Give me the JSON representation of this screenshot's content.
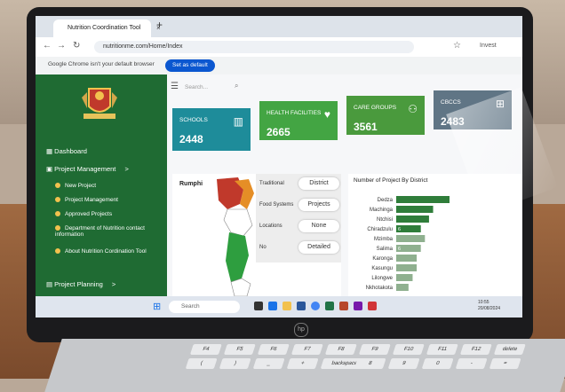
{
  "browser": {
    "tab_title": "Nutrition Coordination Tool",
    "tab_close": "×",
    "new_tab": "+",
    "url": "nutritionme.com/Home/Index",
    "infobar_text": "Google Chrome isn't your default browser",
    "set_default": "Set as default",
    "profile": "Invest"
  },
  "sidebar": {
    "items": [
      {
        "label": "Dashboard"
      },
      {
        "label": "Project Management",
        "arrow": ">"
      },
      {
        "label": "Project Planning",
        "arrow": ">"
      }
    ],
    "sub_items": [
      {
        "label": "New Project"
      },
      {
        "label": "Project Management"
      },
      {
        "label": "Approved Projects"
      },
      {
        "label": "Department of Nutrition contact information"
      },
      {
        "label": "About Nutrition Cordination Tool"
      }
    ]
  },
  "main": {
    "search_placeholder": "Search...",
    "cards": [
      {
        "title": "SCHOOLS",
        "value": "2448",
        "color": "#1e8c9a"
      },
      {
        "title": "HEALTH FACILITIES",
        "value": "2665",
        "color": "#43a543"
      },
      {
        "title": "CARE GROUPS",
        "value": "3561",
        "color": "#4a9a3d"
      },
      {
        "title": "CBCCS",
        "value": "2483",
        "color": "#607585"
      }
    ],
    "map_label": "Rumphi",
    "popup": [
      {
        "left": "Traditional",
        "pill": "District"
      },
      {
        "left": "Food Systems",
        "pill": "Projects"
      },
      {
        "left": "Locations",
        "pill": "None"
      },
      {
        "left": "No",
        "pill": "Detailed"
      }
    ]
  },
  "chart_data": {
    "type": "bar",
    "title": "Number of Project By District",
    "categories": [
      "Dedza",
      "Machinga",
      "Ntchisi",
      "Chiradzulu",
      "Mzimba",
      "Salima",
      "Karonga",
      "Kasungu",
      "Lilongwe",
      "Nkhotakota"
    ],
    "values": [
      13,
      9,
      8,
      6,
      7,
      6,
      5,
      5,
      4,
      3
    ],
    "data_labels": [
      "",
      "",
      "",
      "6",
      "",
      "6",
      "",
      "",
      "",
      ""
    ]
  },
  "taskbar": {
    "search": "Search",
    "time": "10:55",
    "date": "20/08/2024"
  },
  "laptop": {
    "brand": "hp"
  },
  "keys": [
    "F4",
    "F5",
    "F6",
    "F7",
    "F8",
    "F9",
    "F10",
    "F11",
    "F12",
    "delete",
    "(",
    ")",
    "_",
    "+",
    "backspace",
    "8",
    "9",
    "0",
    "-",
    "="
  ]
}
